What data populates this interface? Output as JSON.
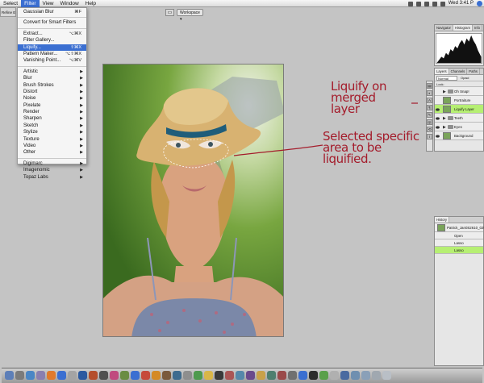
{
  "menubar": {
    "items": [
      "Select",
      "Filter",
      "View",
      "Window",
      "Help"
    ],
    "active_index": 1,
    "clock": "Wed 3:41 P"
  },
  "left_strip": {
    "label": "Refine Edge..."
  },
  "filter_menu": {
    "groups": [
      [
        {
          "label": "Gaussian Blur",
          "shortcut": "⌘F"
        }
      ],
      [
        {
          "label": "Convert for Smart Filters",
          "shortcut": ""
        }
      ],
      [
        {
          "label": "Extract...",
          "shortcut": "⌥⌘X"
        },
        {
          "label": "Filter Gallery...",
          "shortcut": ""
        },
        {
          "label": "Liquify...",
          "shortcut": "⇧⌘X"
        },
        {
          "label": "Pattern Maker...",
          "shortcut": "⌥⇧⌘X"
        },
        {
          "label": "Vanishing Point...",
          "shortcut": "⌥⌘V"
        }
      ],
      [
        {
          "label": "Artistic",
          "submenu": true
        },
        {
          "label": "Blur",
          "submenu": true
        },
        {
          "label": "Brush Strokes",
          "submenu": true
        },
        {
          "label": "Distort",
          "submenu": true
        },
        {
          "label": "Noise",
          "submenu": true
        },
        {
          "label": "Pixelate",
          "submenu": true
        },
        {
          "label": "Render",
          "submenu": true
        },
        {
          "label": "Sharpen",
          "submenu": true
        },
        {
          "label": "Sketch",
          "submenu": true
        },
        {
          "label": "Stylize",
          "submenu": true
        },
        {
          "label": "Texture",
          "submenu": true
        },
        {
          "label": "Video",
          "submenu": true
        },
        {
          "label": "Other",
          "submenu": true
        }
      ],
      [
        {
          "label": "Digimarc",
          "submenu": true
        },
        {
          "label": "Imagenomic",
          "submenu": true
        },
        {
          "label": "Topaz Labs",
          "submenu": true
        }
      ]
    ],
    "selected_label": "Liquify..."
  },
  "toolbar": {
    "workspace_label": "Workspace ▾"
  },
  "annotations": {
    "liquify_note": "Liquify on merged\nlayer",
    "selected_note": "Selected specific\narea to be liquified."
  },
  "panels": {
    "navigator_tabs": [
      "Navigator",
      "Histogram",
      "Info"
    ],
    "navigator_active": 1,
    "layers_tabs": [
      "Layers",
      "Channels",
      "Paths"
    ],
    "layers_mode": "Normal",
    "layers_opacity_label": "Opaci",
    "layers_lock_label": "Lock:",
    "layers": [
      {
        "name": "Oh Snap!",
        "type": "folder",
        "eye": false,
        "selected": false
      },
      {
        "name": "Portraiture",
        "type": "layer",
        "eye": false,
        "selected": false
      },
      {
        "name": "Liquify Layer",
        "type": "layer",
        "eye": true,
        "selected": true
      },
      {
        "name": "Teeth",
        "type": "folder",
        "eye": true,
        "selected": false
      },
      {
        "name": "Eyes",
        "type": "folder",
        "eye": true,
        "selected": false
      },
      {
        "name": "Background",
        "type": "layer",
        "eye": true,
        "selected": false
      }
    ],
    "history_tabs": [
      "History"
    ],
    "history_snapshot": "Patrick_Jan0S2610_029",
    "history": [
      {
        "name": "Open",
        "selected": false
      },
      {
        "name": "Lasso",
        "selected": false
      },
      {
        "name": "Lasso",
        "selected": true
      }
    ]
  },
  "colors": {
    "annotation": "#a41c2b",
    "selection_blue": "#3b6fd1",
    "selected_row_green": "#b6ef73"
  }
}
